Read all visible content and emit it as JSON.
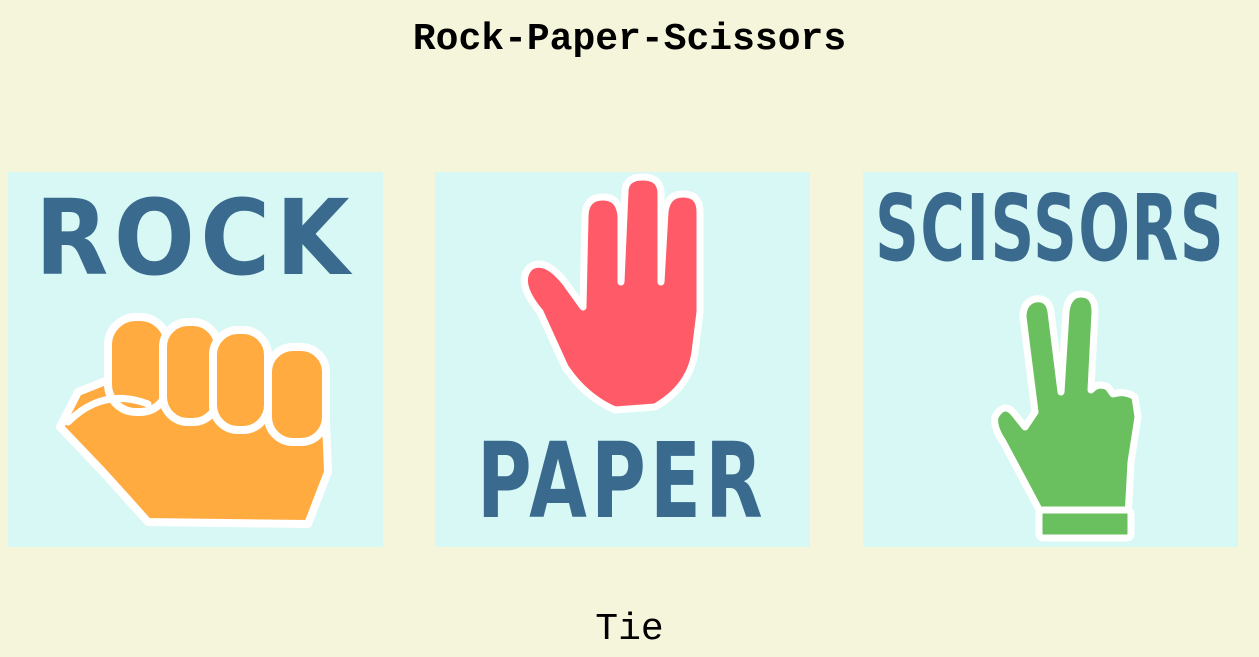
{
  "title": "Rock-Paper-Scissors",
  "choices": [
    {
      "label": "ROCK",
      "icon": "fist-icon",
      "icon_color": "#ffab40"
    },
    {
      "label": "PAPER",
      "icon": "open-hand-icon",
      "icon_color": "#ff5a67"
    },
    {
      "label": "SCISSORS",
      "icon": "victory-hand-icon",
      "icon_color": "#6abf5f"
    }
  ],
  "colors": {
    "background": "#f5f5dc",
    "card_background": "#d8f8f6",
    "label_text": "#3a6a8e"
  },
  "result": "Tie"
}
